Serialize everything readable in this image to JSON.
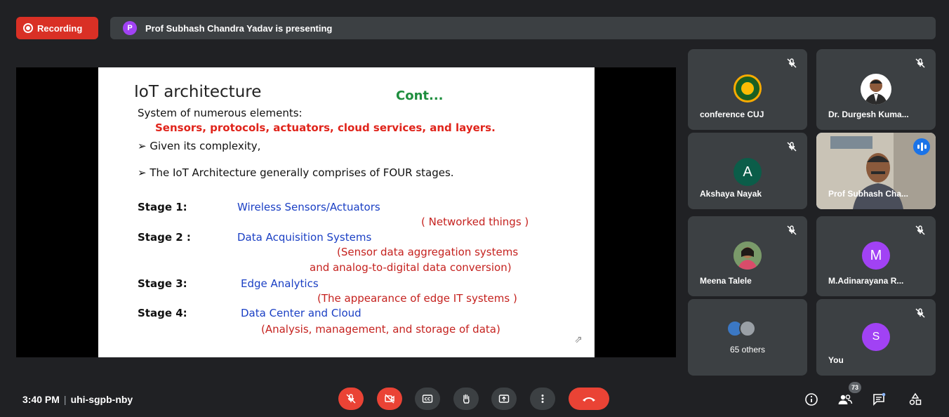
{
  "recording": {
    "label": "Recording"
  },
  "presenter": {
    "initial": "P",
    "text": "Prof Subhash Chandra Yadav is presenting"
  },
  "slide": {
    "title": "IoT architecture",
    "cont": "Cont...",
    "system_line": "System of numerous elements:",
    "elements": "Sensors, protocols, actuators, cloud services, and layers.",
    "given": "➢  Given its complexity,",
    "four_stages": "➢ The IoT Architecture generally comprises of  FOUR stages.",
    "stages": [
      {
        "label": "Stage 1:",
        "name": "Wireless Sensors/Actuators",
        "detail": [
          "( Networked things )"
        ]
      },
      {
        "label": "Stage 2 :",
        "name": "Data Acquisition Systems",
        "detail": [
          "(Sensor data aggregation systems",
          "and analog-to-digital data conversion)"
        ]
      },
      {
        "label": "Stage 3:",
        "name": "Edge Analytics",
        "detail": [
          "(The appearance of edge IT systems )"
        ]
      },
      {
        "label": "Stage 4:",
        "name": "Data Center and Cloud",
        "detail": [
          "(Analysis, management, and storage of data)"
        ]
      }
    ]
  },
  "participants": [
    {
      "name": "conference CUJ",
      "type": "logo",
      "muted": true
    },
    {
      "name": "Dr. Durgesh Kuma...",
      "type": "photo",
      "muted": true
    },
    {
      "name": "Akshaya Nayak",
      "initial": "A",
      "avatar_color": "#0b5d49",
      "muted": true
    },
    {
      "name": "Prof Subhash Cha...",
      "type": "video",
      "speaking": true
    },
    {
      "name": "Meena Talele",
      "type": "photo",
      "muted": true
    },
    {
      "name": "M.Adinarayana R...",
      "initial": "M",
      "avatar_color": "#a142f4",
      "muted": true
    },
    {
      "name": "65 others",
      "type": "group"
    },
    {
      "name": "You",
      "initial": "S",
      "avatar_color": "#a142f4",
      "muted": true
    }
  ],
  "bottom": {
    "time": "3:40 PM",
    "meeting_code": "uhi-sgpb-nby",
    "participant_count": "73"
  },
  "colors": {
    "red": "#ea4335",
    "dark": "#202124",
    "tile": "#3c4043",
    "accent": "#8ab4f8"
  }
}
